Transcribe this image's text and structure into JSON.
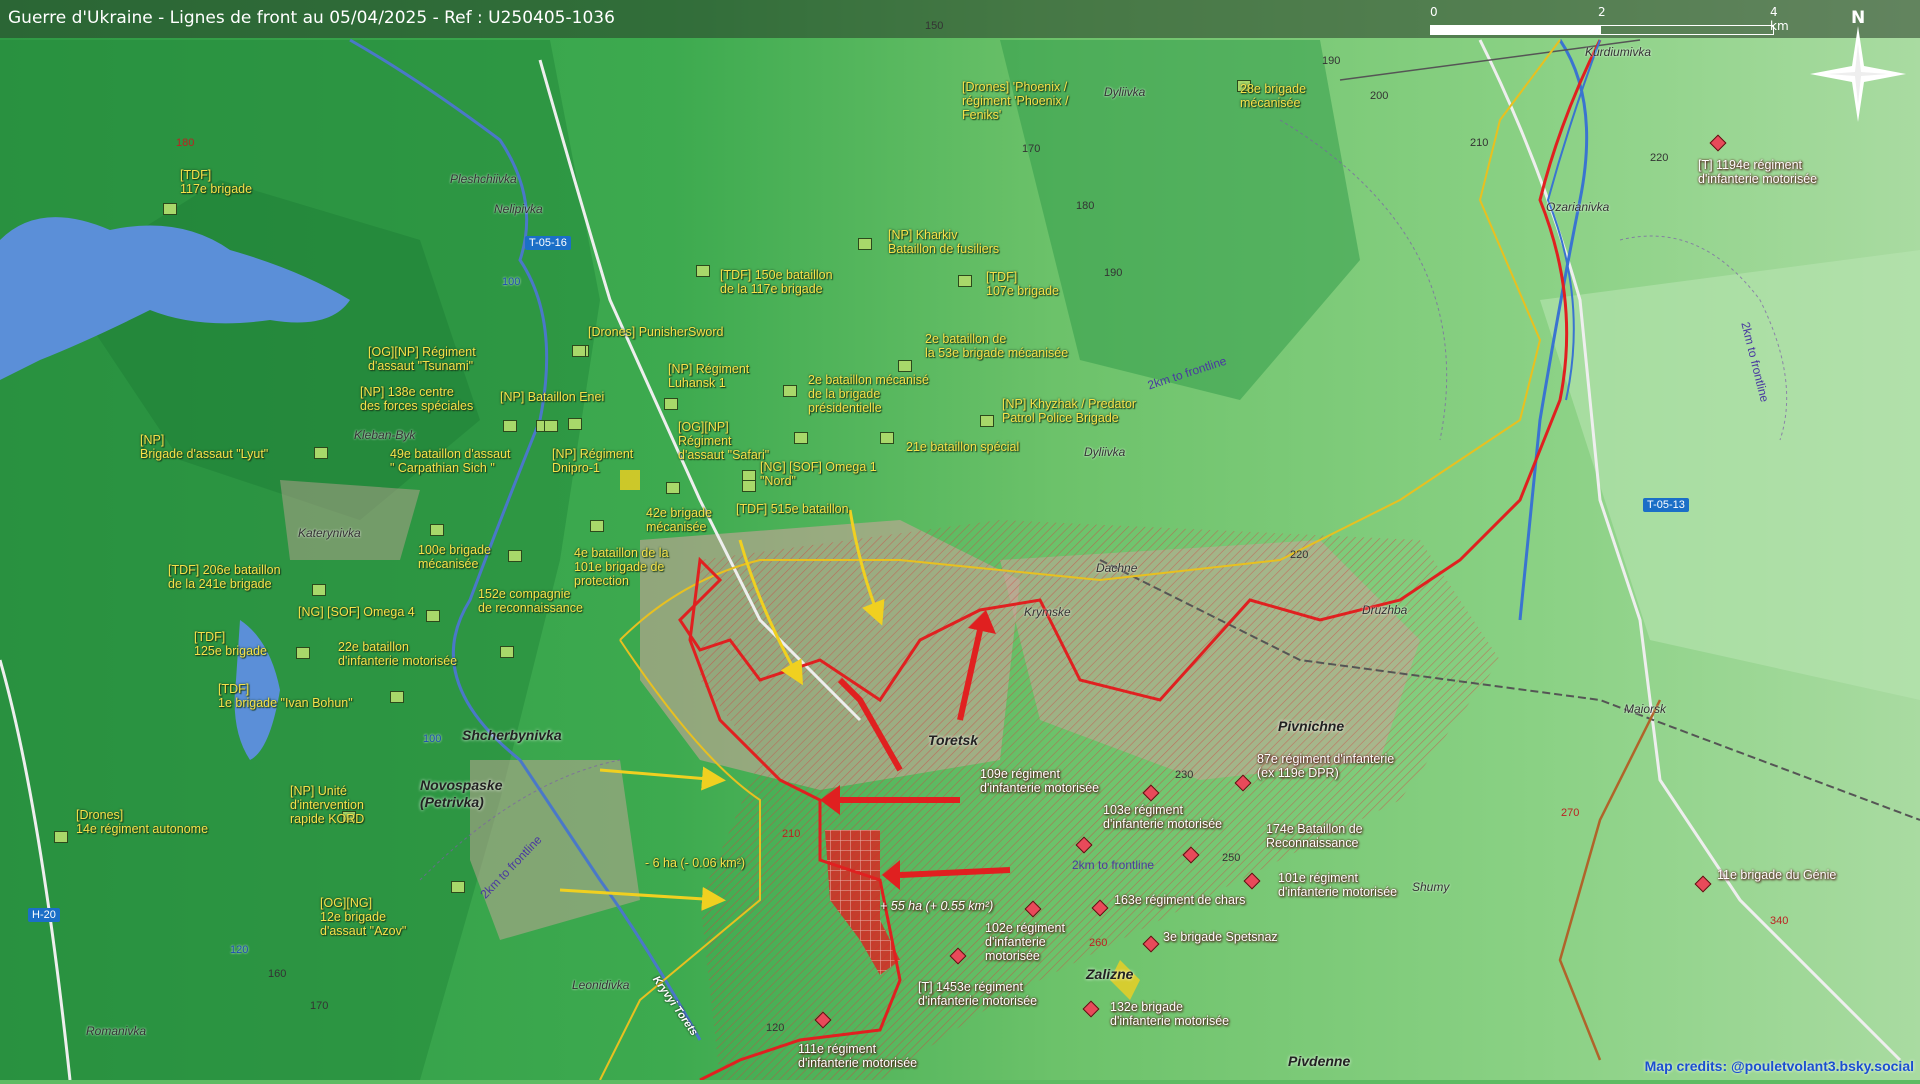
{
  "header": {
    "title": "Guerre d'Ukraine - Lignes de front au 05/04/2025 - Ref : U250405-1036"
  },
  "scale": {
    "ticks": [
      "0",
      "2",
      "4 km"
    ]
  },
  "compass": {
    "north": "N"
  },
  "colors": {
    "ukraine_unit": "#a8d86a",
    "russia_unit": "#e84a5a",
    "frontline_red": "#e02020",
    "frontline_yellow": "#e8c020",
    "label_yellow": "#f6e24a",
    "credits_blue": "#1b4fd0"
  },
  "ukraine_units": [
    {
      "label": "[TDF]\n117e brigade"
    },
    {
      "label": "[Drones] 'Phoenix /\nrégiment 'Phoenix /\nFeniks'"
    },
    {
      "label": "28e brigade\nmécanisée"
    },
    {
      "label": "[NP] Kharkiv\nBataillon de fusiliers"
    },
    {
      "label": "[TDF] 150e bataillon\nde la 117e brigade"
    },
    {
      "label": "[TDF]\n107e brigade"
    },
    {
      "label": "[Drones] PunisherSword"
    },
    {
      "label": "[OG][NP] Régiment\nd'assaut \"Tsunami\""
    },
    {
      "label": "2e bataillon de\nla 53e brigade mécanisée"
    },
    {
      "label": "[NP] 138e centre\ndes forces spéciales"
    },
    {
      "label": "[NP] Bataillon Enei"
    },
    {
      "label": "[NP] Régiment\nLuhansk 1"
    },
    {
      "label": "2e bataillon mécanisé\nde la brigade\nprésidentielle"
    },
    {
      "label": "[NP] Khyzhak / Predator\nPatrol Police Brigade"
    },
    {
      "label": "[NP]\nBrigade d'assaut \"Lyut\""
    },
    {
      "label": "49e bataillon d'assaut\n\" Carpathian Sich \""
    },
    {
      "label": "[NP] Régiment\nDnipro-1"
    },
    {
      "label": "[OG][NP]\nRégiment\nd'assaut \"Safari\""
    },
    {
      "label": "21e bataillon spécial"
    },
    {
      "label": "[NG] [SOF] Omega 1\n\"Nord\""
    },
    {
      "label": "[TDF] 515e bataillon"
    },
    {
      "label": "42e brigade\nmécanisée"
    },
    {
      "label": "100e brigade\nmécanisée"
    },
    {
      "label": "4e bataillon de la\n101e brigade de\nprotection"
    },
    {
      "label": "[TDF] 206e bataillon\nde la 241e brigade"
    },
    {
      "label": "152e compagnie\nde reconnaissance"
    },
    {
      "label": "[NG] [SOF] Omega 4"
    },
    {
      "label": "[TDF]\n125e brigade"
    },
    {
      "label": "22e bataillon\nd'infanterie motorisée"
    },
    {
      "label": "[TDF]\n1e brigade \"Ivan Bohun\""
    },
    {
      "label": "[Drones]\n14e régiment autonome"
    },
    {
      "label": "[NP] Unité\nd'intervention\nrapide KORD"
    },
    {
      "label": "[OG][NG]\n12e brigade\nd'assaut \"Azov\""
    }
  ],
  "russia_units": [
    {
      "label": "[T] 1194e régiment\nd'infanterie motorisée"
    },
    {
      "label": "109e régiment\nd'infanterie motorisée"
    },
    {
      "label": "87e régiment d'infanterie\n(ex 119e DPR)"
    },
    {
      "label": "103e régiment\nd'infanterie motorisée"
    },
    {
      "label": "174e Bataillon de\nReconnaissance"
    },
    {
      "label": "101e régiment\nd'infanterie motorisée"
    },
    {
      "label": "163e régiment de chars"
    },
    {
      "label": "102e régiment\nd'infanterie\nmotorisée"
    },
    {
      "label": "3e brigade Spetsnaz"
    },
    {
      "label": "[T] 1453e régiment\nd'infanterie motorisée"
    },
    {
      "label": "132e brigade\nd'infanterie motorisée"
    },
    {
      "label": "111e régiment\nd'infanterie motorisée"
    },
    {
      "label": "11e brigade du Génie"
    }
  ],
  "places": {
    "pleshchiivka": "Pleshchiivka",
    "nelipivka": "Nelipivka",
    "dyliivka_n": "Dyliivka",
    "kurdiumivka": "Kurdiumivka",
    "ozarianivka": "Ozarianivka",
    "kleban_byk": "Kleban-Byk",
    "katerynivka": "Katerynivka",
    "dyliivka_s": "Dyliivka",
    "dachne": "Dachne",
    "krymske": "Krymske",
    "druzhba": "Druzhba",
    "maiorsk": "Maiorsk",
    "shumy": "Shumy",
    "leonidivka": "Leonidivka",
    "romanivka": "Romanivka"
  },
  "towns": {
    "toretsk": "Toretsk",
    "shcherbynivka": "Shcherbynivka",
    "novospaske": "Novospaske\n(Petrivka)",
    "pivnichne": "Pivnichne",
    "zalizne": "Zalizne",
    "pivdenne": "Pivdenne"
  },
  "roads": {
    "t0516": "T-05-16",
    "t0513": "T-05-13",
    "h20": "H-20",
    "r100a": "100",
    "r100b": "100",
    "r120": "120"
  },
  "elevations": [
    "150",
    "190",
    "200",
    "210",
    "220",
    "180",
    "170",
    "180",
    "190",
    "220",
    "230",
    "250",
    "260",
    "180",
    "160",
    "170",
    "120",
    "260",
    "210",
    "270",
    "340"
  ],
  "annotations": {
    "loss": "- 6 ha (- 0.06 km²)",
    "gain": "+ 55 ha (+ 0.55 km²)",
    "area_fishtail": "Kryvyi Torets",
    "frontline_1": "2km to frontline",
    "frontline_2": "2km to frontline",
    "frontline_3": "2km to frontline",
    "frontline_4": "2km to frontline"
  },
  "credits": "Map credits: @pouletvolant3.bsky.social"
}
